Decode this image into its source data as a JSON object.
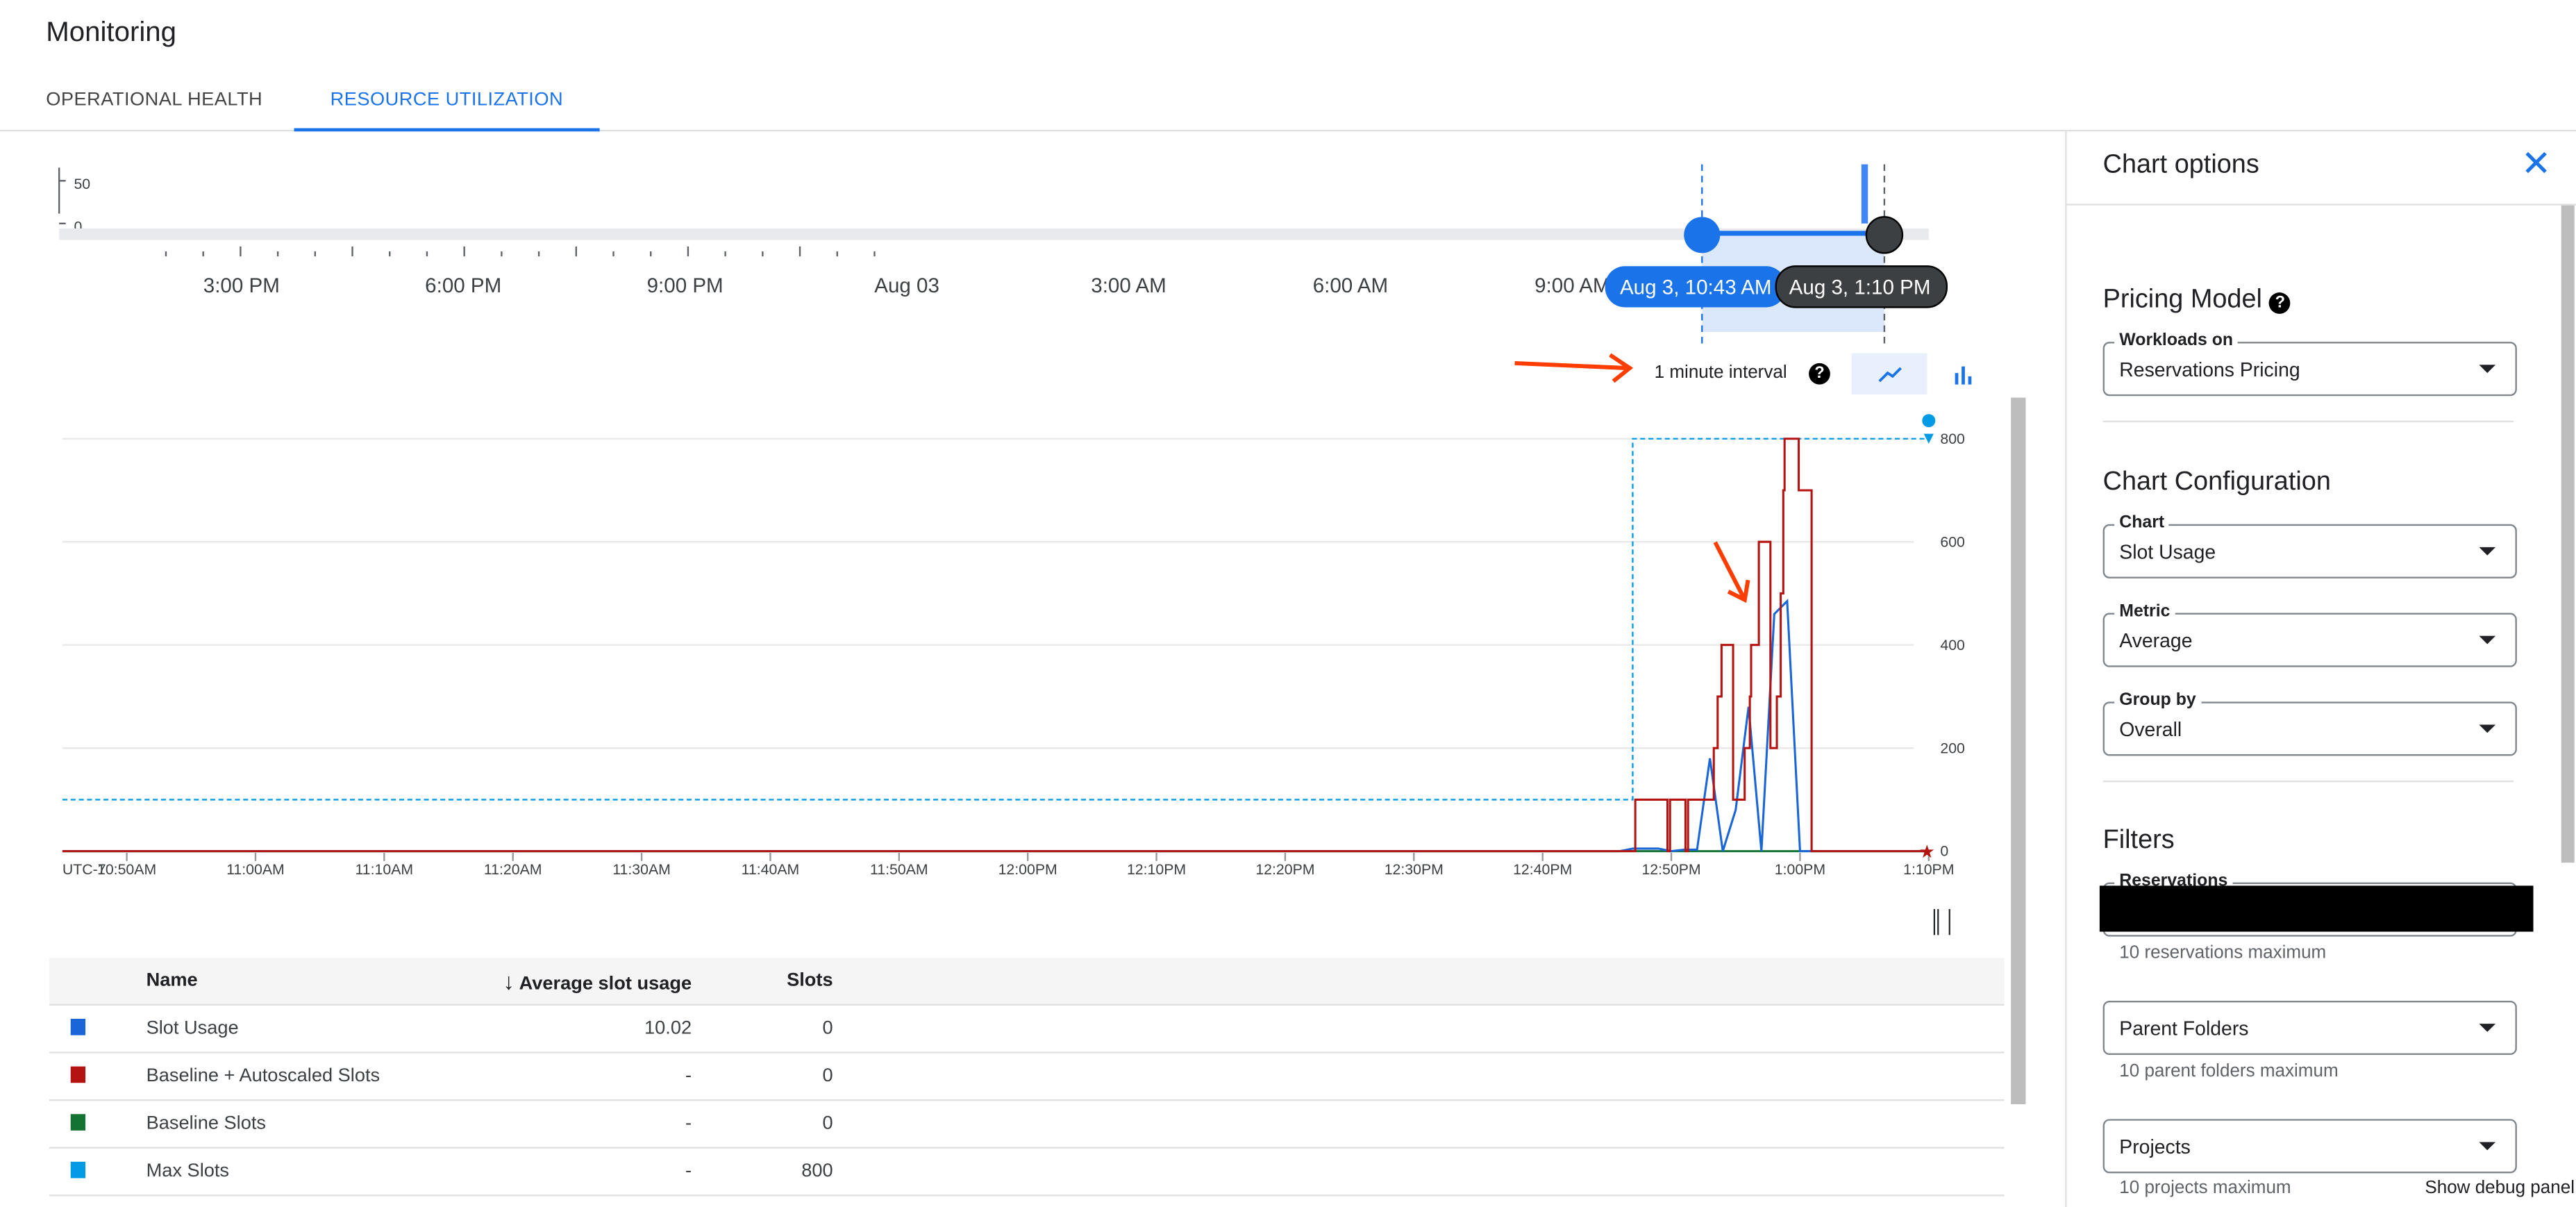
{
  "header": {
    "title": "Monitoring"
  },
  "tabs": [
    {
      "label": "OPERATIONAL HEALTH",
      "active": false
    },
    {
      "label": "RESOURCE UTILIZATION",
      "active": true
    }
  ],
  "overview": {
    "y_ticks": [
      "50",
      "0"
    ],
    "x_ticks": [
      "3:00 PM",
      "6:00 PM",
      "9:00 PM",
      "Aug 03",
      "3:00 AM",
      "6:00 AM",
      "9:00 AM"
    ],
    "range_start": "Aug 3, 10:43 AM",
    "range_end": "Aug 3, 1:10 PM"
  },
  "toolbar": {
    "interval": "1 minute interval",
    "help_icon": "help-circle-icon",
    "line_icon": "line-chart-icon",
    "bar_icon": "bar-chart-icon"
  },
  "chart_data": {
    "type": "line",
    "timezone": "UTC-7",
    "x_ticks": [
      "10:50AM",
      "11:00AM",
      "11:10AM",
      "11:20AM",
      "11:30AM",
      "11:40AM",
      "11:50AM",
      "12:00PM",
      "12:10PM",
      "12:20PM",
      "12:30PM",
      "12:40PM",
      "12:50PM",
      "1:00PM",
      "1:10PM"
    ],
    "y_ticks": [
      0,
      200,
      400,
      600,
      800
    ],
    "ylim": [
      0,
      800
    ],
    "xlim": [
      "10:45",
      "13:10"
    ],
    "grid": true,
    "series": [
      {
        "name": "Slot Usage",
        "color": "#1a66d9",
        "step": false,
        "points": [
          [
            "10:45",
            0
          ],
          [
            "12:46",
            0
          ],
          [
            "12:47",
            5
          ],
          [
            "12:49",
            5
          ],
          [
            "12:50",
            0
          ],
          [
            "12:51",
            3
          ],
          [
            "12:52",
            3
          ],
          [
            "12:53",
            180
          ],
          [
            "12:54",
            0
          ],
          [
            "12:55",
            80
          ],
          [
            "12:56",
            280
          ],
          [
            "12:57",
            0
          ],
          [
            "12:58",
            460
          ],
          [
            "12:59",
            485
          ],
          [
            "13:00",
            0
          ],
          [
            "13:10",
            0
          ]
        ]
      },
      {
        "name": "Baseline + Autoscaled Slots",
        "color": "#b31412",
        "step": true,
        "points": [
          [
            "10:45",
            0
          ],
          [
            "12:47.2",
            100
          ],
          [
            "12:49.7",
            0
          ],
          [
            "12:49.9",
            100
          ],
          [
            "12:51.1",
            0
          ],
          [
            "12:51.3",
            100
          ],
          [
            "12:53.3",
            200
          ],
          [
            "12:53.6",
            300
          ],
          [
            "12:53.9",
            400
          ],
          [
            "12:54.8",
            100
          ],
          [
            "12:55.7",
            200
          ],
          [
            "12:56.1",
            300
          ],
          [
            "12:56.2",
            400
          ],
          [
            "12:56.8",
            600
          ],
          [
            "12:57.7",
            200
          ],
          [
            "12:58.2",
            300
          ],
          [
            "12:58.5",
            500
          ],
          [
            "12:58.7",
            700
          ],
          [
            "12:58.8",
            800
          ],
          [
            "12:59.9",
            700
          ],
          [
            "13:00.9",
            0
          ],
          [
            "13:10",
            0
          ]
        ]
      },
      {
        "name": "Baseline Slots",
        "color": "#137333",
        "step": true,
        "points": [
          [
            "10:45",
            0
          ],
          [
            "13:10",
            0
          ]
        ]
      },
      {
        "name": "Max Slots",
        "color": "#039be5",
        "step": true,
        "dashed": true,
        "points": [
          [
            "10:45",
            100
          ],
          [
            "12:47",
            800
          ],
          [
            "13:10",
            800
          ]
        ]
      }
    ]
  },
  "legend": {
    "columns": [
      "Name",
      "Average slot usage",
      "Slots"
    ],
    "rows": [
      {
        "name": "Slot Usage",
        "avg": "10.02",
        "slots": "0",
        "color": "#1a66d9"
      },
      {
        "name": "Baseline + Autoscaled Slots",
        "avg": "-",
        "slots": "0",
        "color": "#b31412"
      },
      {
        "name": "Baseline Slots",
        "avg": "-",
        "slots": "0",
        "color": "#137333"
      },
      {
        "name": "Max Slots",
        "avg": "-",
        "slots": "800",
        "color": "#039be5"
      }
    ]
  },
  "panel": {
    "title": "Chart options",
    "close_icon": "close-icon",
    "pricing": {
      "heading": "Pricing Model",
      "field_label": "Workloads on",
      "value": "Reservations Pricing"
    },
    "config": {
      "heading": "Chart Configuration",
      "chart_label": "Chart",
      "chart_value": "Slot Usage",
      "metric_label": "Metric",
      "metric_value": "Average",
      "group_label": "Group by",
      "group_value": "Overall"
    },
    "filters": {
      "heading": "Filters",
      "reservations_label": "Reservations",
      "reservations_hint": "10 reservations maximum",
      "folders_placeholder": "Parent Folders",
      "folders_hint": "10 parent folders maximum",
      "projects_placeholder": "Projects",
      "projects_hint": "10 projects maximum"
    },
    "debug": "Show debug panel"
  },
  "colors": {
    "accent": "#1a73e8",
    "annotation_arrow": "#ff3d00"
  }
}
